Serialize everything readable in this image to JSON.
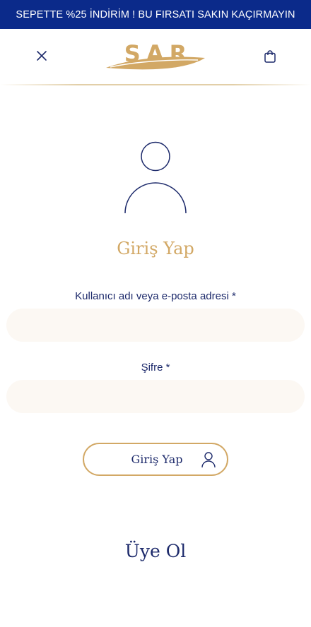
{
  "promo": {
    "text": "SEPETTE %25 İNDİRİM ! BU FIRSATI SAKIN KAÇIRMAYIN"
  },
  "header": {
    "logo_text": "SAR"
  },
  "login": {
    "title": "Giriş Yap",
    "username_label": "Kullanıcı adı veya e-posta adresi *",
    "username_value": "",
    "password_label": "Şifre *",
    "password_value": "",
    "submit_label": "Giriş Yap"
  },
  "register": {
    "title": "Üye Ol"
  },
  "icons": {
    "close": "close-icon",
    "cart": "shopping-bag-icon",
    "avatar": "user-avatar-icon",
    "login_button": "user-icon"
  },
  "colors": {
    "promo_bg": "#0b2a8a",
    "navy": "#1d2a6b",
    "gold": "#d2a865",
    "input_bg": "#fcf8f3"
  }
}
